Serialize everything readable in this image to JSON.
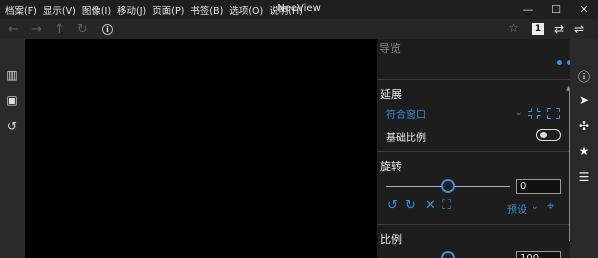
{
  "menubar": {
    "items": [
      "档案(F)",
      "显示(V)",
      "图像(I)",
      "移动(J)",
      "页面(P)",
      "书签(B)",
      "选项(O)",
      "说明(H)"
    ],
    "app_title": "NeeView",
    "controls": {
      "minimize": "—",
      "maximize": "☐",
      "close": "✕"
    }
  },
  "addressbar": {
    "back": "←",
    "forward": "→",
    "up": "↑",
    "reload": "↻",
    "info": "i",
    "bookmark_star": "☆",
    "page_badge": "1",
    "tools": [
      "⇄",
      "⇌"
    ]
  },
  "left_sidebar": {
    "icons": [
      "library-icon",
      "image-icon",
      "history-icon"
    ],
    "glyphs": [
      "▥",
      "▣",
      "↺"
    ]
  },
  "panel": {
    "title": "导览",
    "more": "•••",
    "stretch": {
      "title": "延展",
      "mode": "符合窗口",
      "mode_chevron": "⌄",
      "base_scale_label": "基础比例",
      "base_scale_enabled": false
    },
    "rotate": {
      "title": "旋转",
      "value": "0",
      "slider_fraction": 0.5,
      "rotate_left": "↺",
      "rotate_right": "↻",
      "reset": "✕",
      "fit": "⛶",
      "preset_label": "预设",
      "preset_chevron": "⌄",
      "pin": "⌖"
    },
    "scale": {
      "title": "比例",
      "value": "100",
      "slider_fraction": 0.5
    }
  },
  "right_sidebar": {
    "icons": [
      "info-icon",
      "navigator-icon",
      "effect-icon",
      "bookmark-icon",
      "playlist-icon"
    ],
    "glyphs": [
      "ⓘ",
      "➤",
      "✣",
      "★",
      "☰"
    ]
  },
  "colors": {
    "accent": "#3d8bd8",
    "background": "#222222",
    "viewer": "#000000"
  }
}
